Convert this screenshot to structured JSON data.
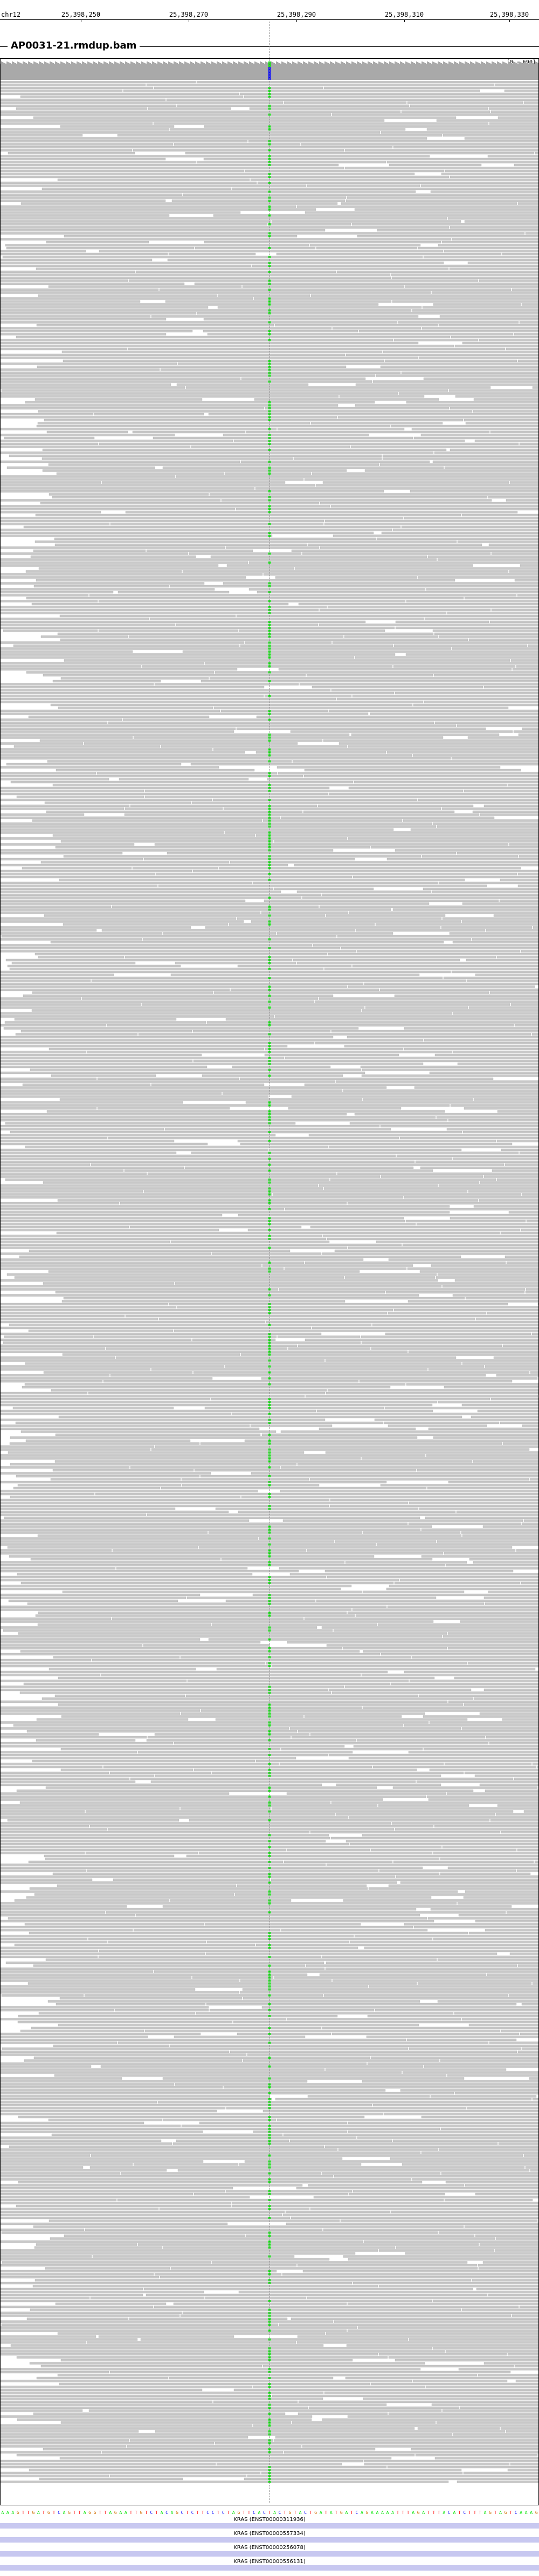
{
  "ruler": {
    "chromosome": "chr12",
    "ticks": [
      "25,398,250",
      "25,398,270",
      "25,398,290",
      "25,398,310",
      "25,398,330"
    ]
  },
  "track": {
    "title": "AP0031-21.rmdup.bam",
    "coverage_scale": "[0 - 690]"
  },
  "reference_sequence": "AAAGTTGATGTCAGTTAGGTTAGAATTGTCTACAGCTCTTCCTCTAGTTCACTACTGTACTGATATGATCAGAAAAATTTAGATTTACATCTTTAGTAGTCAAAG",
  "gene_tracks": [
    "KRAS (ENST00000311936)",
    "KRAS (ENST00000557334)",
    "KRAS (ENST00000256078)",
    "KRAS (ENST00000556131)"
  ],
  "colors": {
    "read": "#c8c8c8",
    "read_edge": "#a0a0a0",
    "coverage": "#a9a9a9",
    "mismatch_A": "#00e600",
    "mismatch_C": "#0000ff",
    "mismatch_G": "#d17105",
    "mismatch_T": "#ff0000",
    "insertion": "#8a2be2",
    "gene": "#c8c8f0"
  }
}
